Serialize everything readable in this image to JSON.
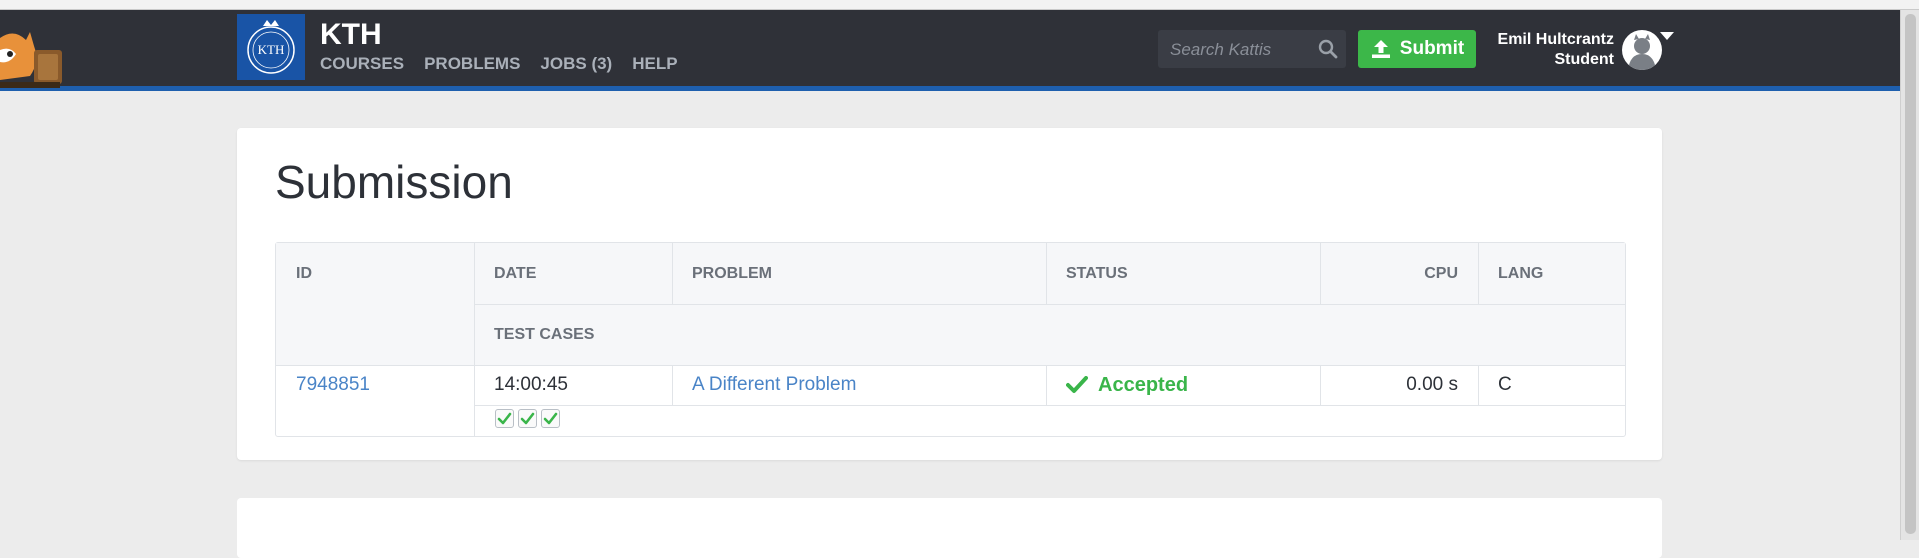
{
  "app": {
    "brand": "KTH",
    "logo_text": "KTH"
  },
  "nav": {
    "items": [
      {
        "label": "COURSES"
      },
      {
        "label": "PROBLEMS"
      },
      {
        "label": "JOBS (3)"
      },
      {
        "label": "HELP"
      }
    ]
  },
  "search": {
    "placeholder": "Search Kattis",
    "value": ""
  },
  "submit": {
    "label": "Submit"
  },
  "user": {
    "name": "Emil Hultcrantz",
    "role": "Student"
  },
  "page": {
    "title": "Submission"
  },
  "table": {
    "headers": {
      "id": "ID",
      "date": "DATE",
      "problem": "PROBLEM",
      "status": "STATUS",
      "cpu": "CPU",
      "lang": "LANG",
      "test_cases": "TEST CASES"
    },
    "row": {
      "id": "7948851",
      "date": "14:00:45",
      "problem": "A Different Problem",
      "status": "Accepted",
      "cpu": "0.00 s",
      "lang": "C",
      "test_cases_passed": 3
    }
  },
  "colors": {
    "navbar": "#2f3138",
    "accent_stripe": "#1e5fae",
    "submit_green": "#3cb749",
    "accepted_green": "#3ab54a",
    "link_blue": "#4a84c7"
  }
}
